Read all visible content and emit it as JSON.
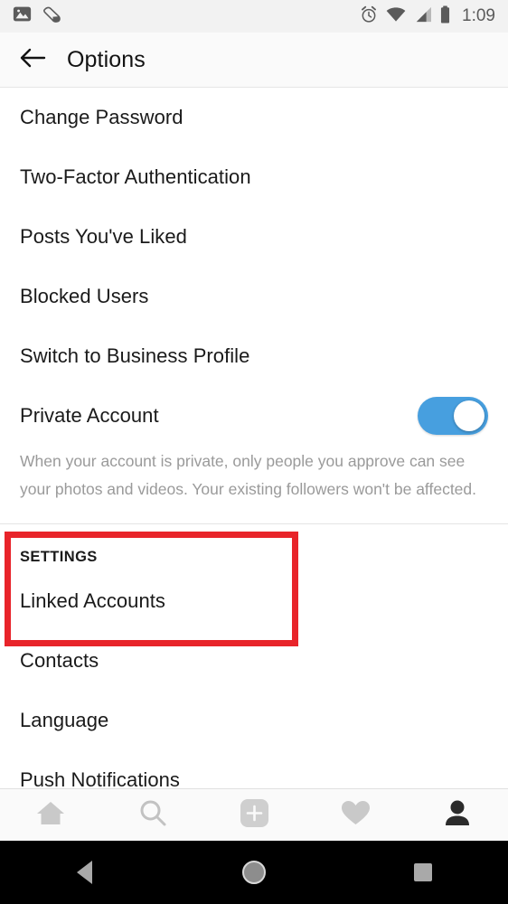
{
  "status_bar": {
    "left_icons": [
      {
        "name": "photo-icon",
        "glyph": "image"
      },
      {
        "name": "fitness-tracker-icon",
        "glyph": "shoe"
      }
    ],
    "right_icons": [
      {
        "name": "alarm-clock-icon"
      },
      {
        "name": "wifi-icon"
      },
      {
        "name": "cellular-signal-icon"
      },
      {
        "name": "battery-icon"
      }
    ],
    "time": "1:09"
  },
  "appbar": {
    "back_icon": "back-arrow-icon",
    "title": "Options"
  },
  "account_section": {
    "items": [
      {
        "label": "Change Password"
      },
      {
        "label": "Two-Factor Authentication"
      },
      {
        "label": "Posts You've Liked"
      },
      {
        "label": "Blocked Users"
      },
      {
        "label": "Switch to Business Profile"
      }
    ],
    "private_account": {
      "label": "Private Account",
      "toggle_on": true,
      "toggle_color": "#479fdf"
    },
    "helper_text": "When your account is private, only people you approve can see your photos and videos. Your existing followers won't be affected."
  },
  "settings_section": {
    "header": "SETTINGS",
    "items": [
      {
        "label": "Linked Accounts"
      },
      {
        "label": "Contacts"
      },
      {
        "label": "Language"
      },
      {
        "label": "Push Notifications"
      }
    ]
  },
  "annotation": {
    "name": "highlight-rectangle",
    "color": "#e8242a"
  },
  "tabbar": {
    "tabs": [
      {
        "name": "home-icon",
        "active": false
      },
      {
        "name": "search-icon",
        "active": false
      },
      {
        "name": "add-post-icon",
        "active": false
      },
      {
        "name": "activity-heart-icon",
        "active": false
      },
      {
        "name": "profile-icon",
        "active": true
      }
    ]
  },
  "navbar": {
    "buttons": [
      {
        "name": "android-back-button"
      },
      {
        "name": "android-home-button"
      },
      {
        "name": "android-recents-button"
      }
    ]
  }
}
